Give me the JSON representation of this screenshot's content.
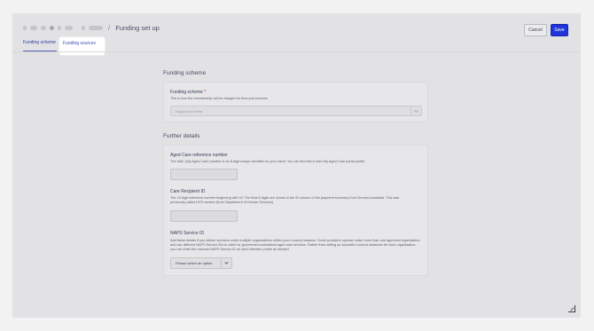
{
  "header": {
    "title": "Funding set up",
    "cancel_label": "Cancel",
    "save_label": "Save"
  },
  "tabs": [
    {
      "label": "Funding scheme"
    },
    {
      "label": "Funding sources"
    }
  ],
  "sections": {
    "funding_scheme": {
      "title": "Funding scheme",
      "field_label": "Funding scheme",
      "required_mark": "*",
      "help": "This is how the membership will be charged for fees and services",
      "select_placeholder": "Support at Home"
    },
    "further_details": {
      "title": "Further details",
      "aged_care": {
        "label": "Aged Care reference number",
        "help": "The MAC (My Aged Care) number is an 8-digit unique identifier for your client. You can find this in their My Aged Care portal profile.",
        "value": ""
      },
      "care_recipient": {
        "label": "Care Recipient ID",
        "help": "The 10-digit reference number beginning with 04. The final 8 digits are shown in the ID column of the payment summary from Services Australia. This was previously called DVS number (from Department of Human Services).",
        "value": ""
      },
      "naps": {
        "label": "NAPS Service ID",
        "help": "Add these details if you deliver services under multiple organisations within your Lookout instance. Some providers operate under more than one approved organisation and use different NAPS Service IDs to claim for government-subsidised aged care services. Rather than setting up separate Lookout instances for each organisation, you can enter the relevant NAPS Service ID on each Member profile as needed.",
        "select_value": "Please select an option"
      }
    }
  },
  "icons": {
    "chevron": "chevron-down-icon",
    "resize": "resize-handle-icon"
  },
  "colors": {
    "primary": "#1f35d9",
    "tab_active": "#3e4cae"
  }
}
